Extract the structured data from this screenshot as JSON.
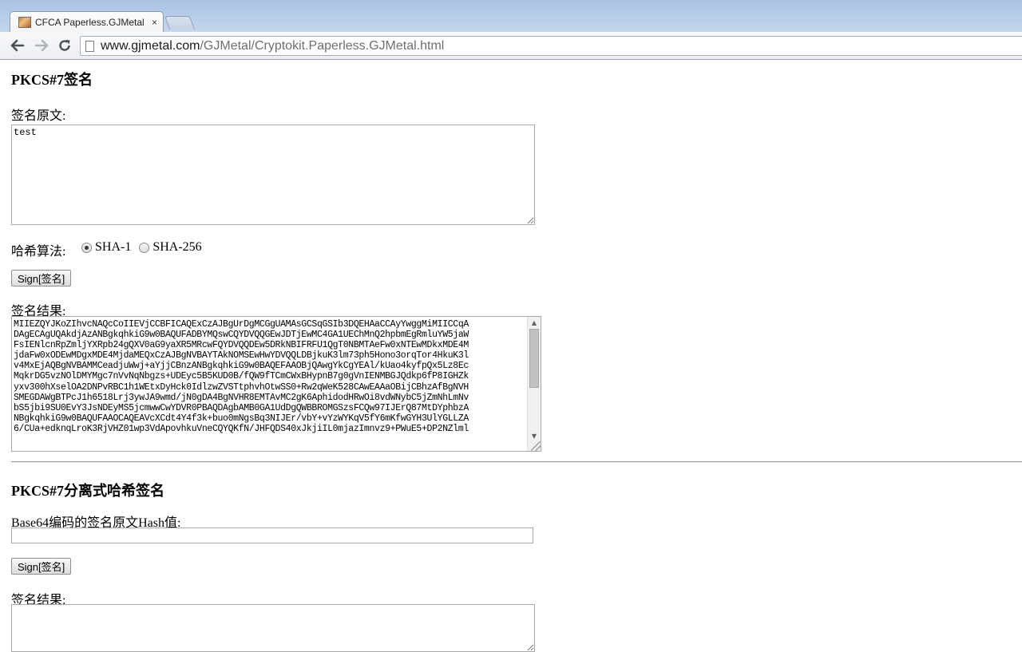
{
  "browser": {
    "tab_title": "CFCA Paperless.GJMetal C",
    "tab_close": "×",
    "url_host": "www.gjmetal.com",
    "url_path": "/GJMetal/Cryptokit.Paperless.GJMetal.html",
    "icons": [
      "back-icon",
      "forward-icon",
      "reload-icon",
      "page-icon",
      "close-icon"
    ]
  },
  "section1": {
    "title": "PKCS#7签名",
    "source_label": "签名原文:",
    "source_value": "test",
    "hash_label": "哈希算法:",
    "hash_options": [
      {
        "label": "SHA-1",
        "checked": true
      },
      {
        "label": "SHA-256",
        "checked": false
      }
    ],
    "sign_button": "Sign[签名]",
    "result_label": "签名结果:",
    "result_lines": [
      "MIIEZQYJKoZIhvcNAQcCoIIEVjCCBFICAQExCzAJBgUrDgMCGgUAMAsGCSqGSIb3DQEHAaCCAyYwggMiMIICCqA",
      "DAgECAgUQAkdjAzANBgkqhkiG9w0BAQUFADBYMQswCQYDVQQGEwJDTjEwMC4GA1UEChMnQ2hpbmEgRmluYW5jaW",
      "FsIENlcnRpZmljYXRpb24gQXV0aG9yaXR5MRcwFQYDVQQDEw5DRkNBIFRFU1QgT0NBMTAeFw0xNTEwMDkxMDE4M",
      "jdaFw0xODEwMDgxMDE4MjdaMEQxCzAJBgNVBAYTAkNOMSEwHwYDVQQLDBjkuK3lm73ph5Hono3orqTor4HkuK3l",
      "v4MxEjAQBgNVBAMMCeadjuWwj+aYjjCBnzANBgkqhkiG9w0BAQEFAAOBjQAwgYkCgYEAl/kUao4kyfpQx5Lz8Ec",
      "MqkrDG5vzNOlDMYMgc7nVvNqNbgzs+UDEyc5B5KUD0B/fQW9fTCmCWxBHypnB7g0gVnIENMBGJQdkp6fP8IGHZk",
      "yxv300hXselOA2DNPvRBC1h1WEtxDyHck0IdlzwZVSTtphvhOtwSS0+Rw2qWeK528CAwEAAaOBijCBhzAfBgNVH",
      "SMEGDAWgBTPcJ1h6518Lrj3ywJA9wmd/jN0gDA4BgNVHR8EMTAvMC2gK6AphidodHRwOi8vdWNybC5jZmNhLmNv",
      "bS5jbi9SU0EvY3JsNDEyMS5jcmwwCwYDVR0PBAQDAgbAMB0GA1UdDgQWBBROMGSzsFCQw97IJErQ87MtDYphbzA",
      "NBgkqhkiG9w0BAQUFAAOCAQEAVcXCdt4Y4f3k+buo0mNgsBq3NIJEr/vbY+vYzWYKqV5fY6mKfwGYH3UlYGLLZA",
      "6/CUa+edknqLroK3RjVHZ01wp3VdApovhkuVneCQYQKfN/JHFQDS40xJkjiIL0mjazImnvz9+PWuE5+DP2NZlml"
    ]
  },
  "section2": {
    "title": "PKCS#7分离式哈希签名",
    "hash_input_label": "Base64编码的签名原文Hash值:",
    "hash_input_value": "",
    "sign_button": "Sign[签名]",
    "result_label": "签名结果:",
    "result_value": ""
  }
}
